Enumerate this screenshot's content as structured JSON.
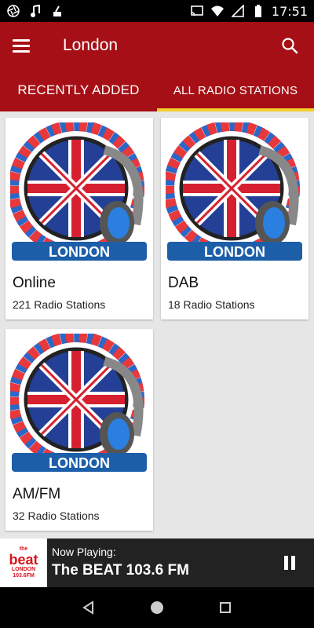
{
  "status_bar": {
    "time": "17:51"
  },
  "app_bar": {
    "title": "London"
  },
  "tabs": [
    {
      "label": "RECENTLY ADDED"
    },
    {
      "label": "ALL RADIO STATIONS"
    }
  ],
  "cards": [
    {
      "name": "Online",
      "count": "221 Radio Stations",
      "badge": "LONDON"
    },
    {
      "name": "DAB",
      "count": "18 Radio Stations",
      "badge": "LONDON"
    },
    {
      "name": "AM/FM",
      "count": "32 Radio Stations",
      "badge": "LONDON"
    }
  ],
  "player": {
    "label": "Now Playing:",
    "station": "The BEAT 103.6 FM",
    "logo_word": "beat",
    "logo_top": "the",
    "logo_city": "LONDON",
    "logo_freq": "103.6FM"
  },
  "colors": {
    "app_bar": "#a60f15",
    "tab_indicator": "#f4d02a",
    "player_bg": "#222222"
  }
}
